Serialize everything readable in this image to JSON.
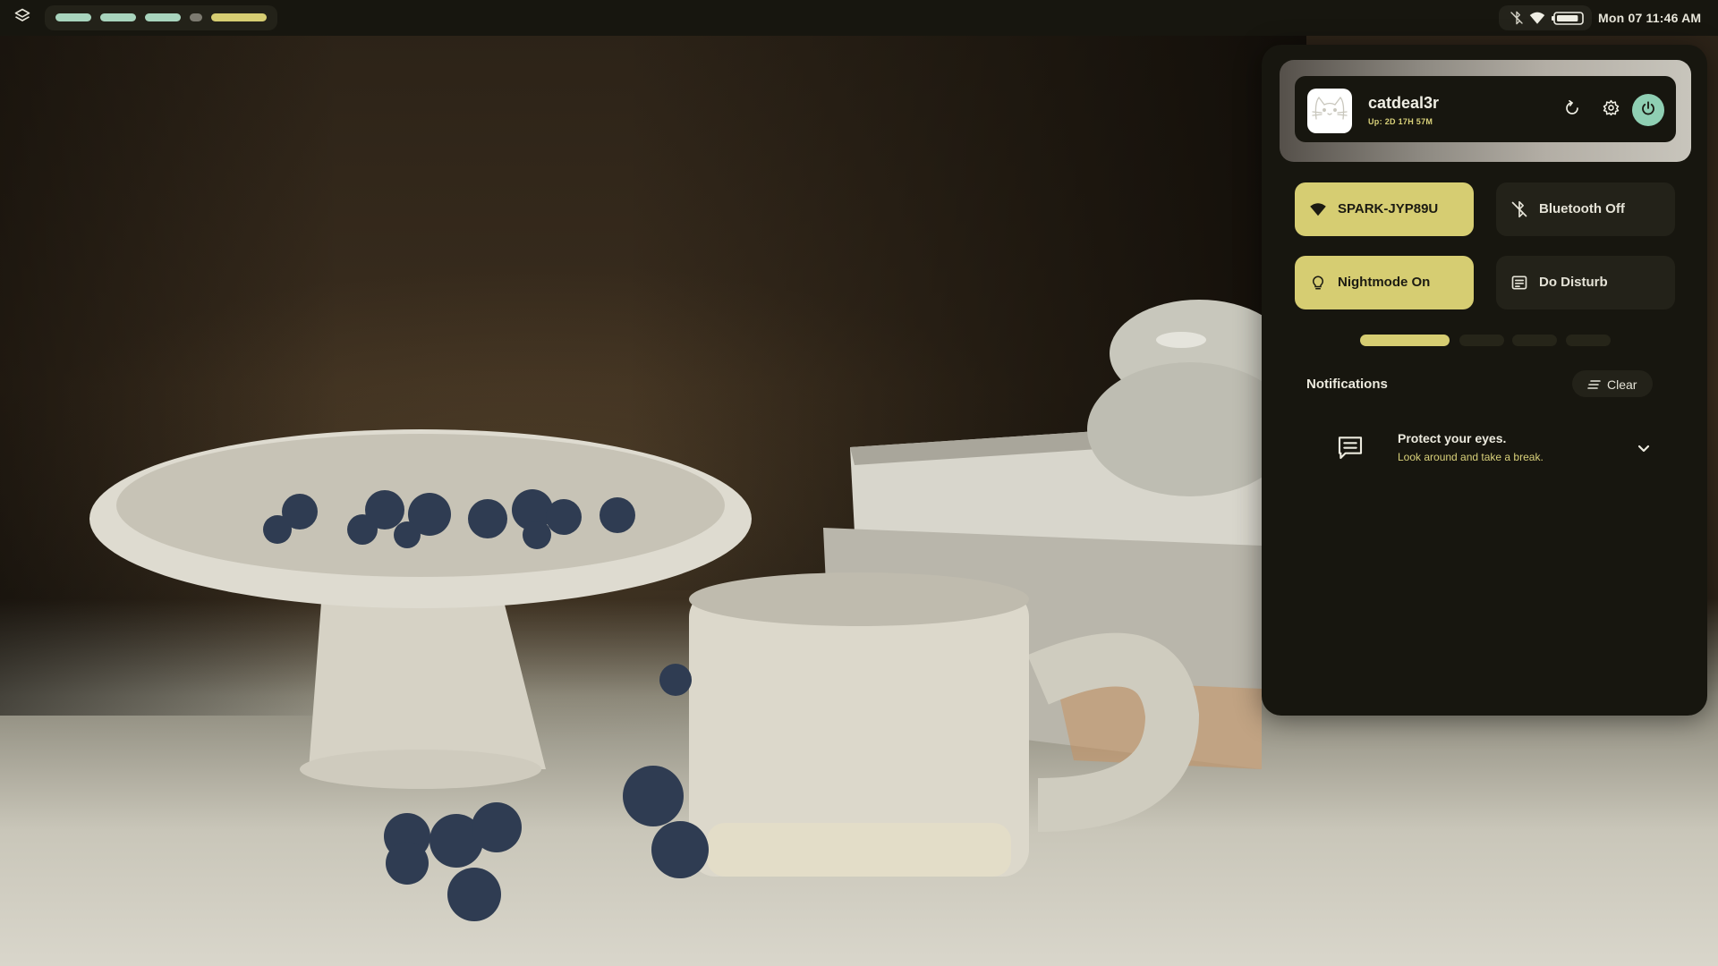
{
  "topbar": {
    "launcher_icon": "layers-icon",
    "workspaces": [
      {
        "state": "occupied",
        "color": "#a8d4bd"
      },
      {
        "state": "occupied",
        "color": "#a8d4bd"
      },
      {
        "state": "occupied",
        "color": "#a8d4bd"
      },
      {
        "state": "empty",
        "color": "#7c7a70"
      },
      {
        "state": "active",
        "color": "#d6cd72"
      }
    ],
    "tray": {
      "icons": [
        "bluetooth-off-icon",
        "wifi-icon",
        "battery-icon"
      ],
      "battery_level": 0.9
    },
    "clock": "Mon 07  11:46 AM"
  },
  "control_center": {
    "profile": {
      "username": "catdeal3r",
      "uptime": "Up: 2D 17H 57M",
      "avatar_icon": "cat-avatar-icon",
      "buttons": {
        "reload_icon": "reload-icon",
        "settings_icon": "gear-icon",
        "power_icon": "power-icon"
      }
    },
    "tiles": [
      {
        "label": "SPARK-JYP89U",
        "icon": "wifi-icon",
        "active": true
      },
      {
        "label": "Bluetooth Off",
        "icon": "bluetooth-off-icon",
        "active": false
      },
      {
        "label": "Nightmode On",
        "icon": "lightbulb-icon",
        "active": true
      },
      {
        "label": "Do Disturb",
        "icon": "notes-icon",
        "active": false
      }
    ],
    "pages": {
      "count": 4,
      "current": 1
    },
    "notifications": {
      "title": "Notifications",
      "clear_label": "Clear",
      "items": [
        {
          "title": "Protect your eyes.",
          "body": "Look around and take a break.",
          "icon": "message-icon"
        }
      ]
    }
  },
  "colors": {
    "accent": "#d6cd72",
    "accent_text": "#d9d17a",
    "mint": "#8fcfb3",
    "panel_bg": "#17160f",
    "surface": "#232219"
  }
}
